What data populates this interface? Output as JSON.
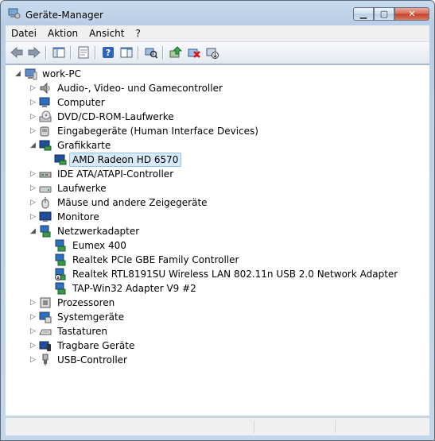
{
  "window": {
    "title": "Geräte-Manager"
  },
  "menu": [
    "Datei",
    "Aktion",
    "Ansicht",
    "?"
  ],
  "toolbar": {
    "buttons": [
      "back-arrow-icon",
      "forward-arrow-icon",
      "show-hide-console-tree-icon",
      "properties-icon",
      "help-icon",
      "action-pane-icon",
      "scan-hardware-icon",
      "update-driver-icon",
      "uninstall-icon",
      "disable-icon"
    ]
  },
  "tree": {
    "root": "work-PC",
    "items": [
      {
        "label": "Audio-, Video- und Gamecontroller",
        "icon": "speaker-icon",
        "expanded": false
      },
      {
        "label": "Computer",
        "icon": "computer-icon",
        "expanded": false
      },
      {
        "label": "DVD/CD-ROM-Laufwerke",
        "icon": "cd-drive-icon",
        "expanded": false
      },
      {
        "label": "Eingabegeräte (Human Interface Devices)",
        "icon": "hid-icon",
        "expanded": false
      },
      {
        "label": "Grafikkarte",
        "icon": "display-adapter-icon",
        "expanded": true,
        "children": [
          {
            "label": "AMD Radeon HD 6570",
            "icon": "display-adapter-icon",
            "selected": true
          }
        ]
      },
      {
        "label": "IDE ATA/ATAPI-Controller",
        "icon": "ide-controller-icon",
        "expanded": false
      },
      {
        "label": "Laufwerke",
        "icon": "disk-drive-icon",
        "expanded": false
      },
      {
        "label": "Mäuse und andere Zeigegeräte",
        "icon": "mouse-icon",
        "expanded": false
      },
      {
        "label": "Monitore",
        "icon": "monitor-icon",
        "expanded": false
      },
      {
        "label": "Netzwerkadapter",
        "icon": "network-adapter-icon",
        "expanded": true,
        "children": [
          {
            "label": "Eumex 400",
            "icon": "network-adapter-icon"
          },
          {
            "label": "Realtek PCIe GBE Family Controller",
            "icon": "network-adapter-icon"
          },
          {
            "label": "Realtek RTL8191SU Wireless LAN 802.11n USB 2.0 Network Adapter",
            "icon": "network-adapter-warning-icon"
          },
          {
            "label": "TAP-Win32 Adapter V9 #2",
            "icon": "network-adapter-icon"
          }
        ]
      },
      {
        "label": "Prozessoren",
        "icon": "processor-icon",
        "expanded": false
      },
      {
        "label": "Systemgeräte",
        "icon": "system-device-icon",
        "expanded": false
      },
      {
        "label": "Tastaturen",
        "icon": "keyboard-icon",
        "expanded": false
      },
      {
        "label": "Tragbare Geräte",
        "icon": "portable-device-icon",
        "expanded": false
      },
      {
        "label": "USB-Controller",
        "icon": "usb-icon",
        "expanded": false
      }
    ]
  },
  "colors": {
    "selection": "#d8eaf9",
    "selection_border": "#8ec1ea",
    "title_gradient": "#c9dbee",
    "close_button": "#c4402a"
  }
}
